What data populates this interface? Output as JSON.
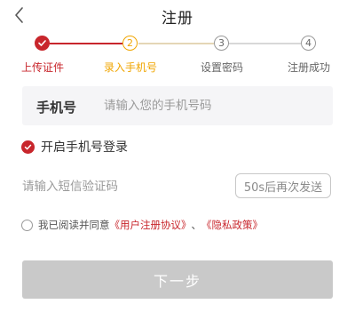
{
  "header": {
    "title": "注册",
    "back_icon": "chevron-left-icon"
  },
  "stepper": {
    "steps": [
      {
        "number": "✓",
        "label": "上传证件",
        "state": "done"
      },
      {
        "number": "2",
        "label": "录入手机号",
        "state": "current"
      },
      {
        "number": "3",
        "label": "设置密码",
        "state": "todo"
      },
      {
        "number": "4",
        "label": "注册成功",
        "state": "todo"
      }
    ]
  },
  "form": {
    "phone_label": "手机号",
    "phone_placeholder": "请输入您的手机号码",
    "phone_login_label": "开启手机号登录",
    "phone_login_enabled": true,
    "sms_placeholder": "请输入短信验证码",
    "resend_label": "50s后再次发送",
    "agreement_prefix": "我已阅读并同意",
    "agreement_link_1": "《用户注册协议》",
    "agreement_separator": "、",
    "agreement_link_2": "《隐私政策》",
    "agreement_checked": false,
    "next_label": "下一步"
  },
  "colors": {
    "brand_red": "#c8262c",
    "current_orange": "#f0a500",
    "inactive_gray": "#b5b5b5",
    "disabled_button": "#c9c9c9"
  }
}
